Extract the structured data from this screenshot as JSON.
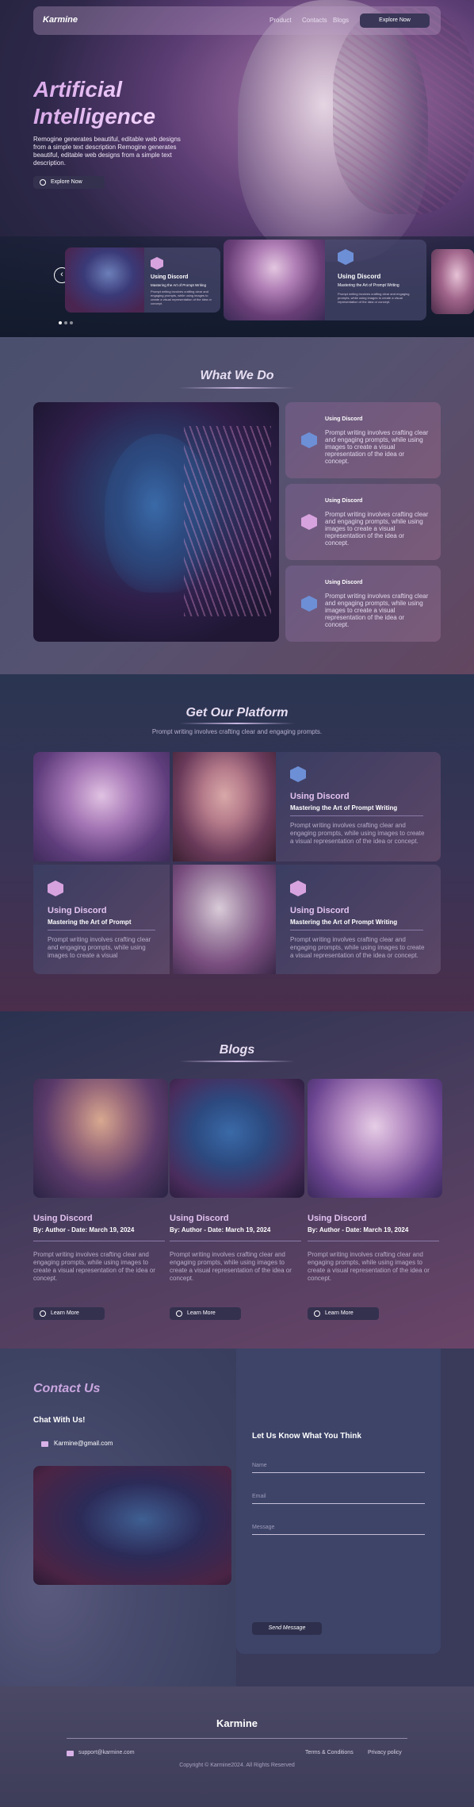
{
  "nav": {
    "logo": "Karmine",
    "links": [
      "Product",
      "Contacts",
      "Blogs"
    ],
    "cta": "Explore Now"
  },
  "hero": {
    "title_line1": "Artificial",
    "title_line2": "Intelligence",
    "description": "Remogine generates beautiful, editable web designs from a simple text description Remogine generates beautiful, editable web designs from a simple text description.",
    "cta": "Explore Now"
  },
  "carousel": {
    "cards": [
      {
        "title": "Using Discord",
        "subtitle": "Mastering the Art of Prompt Writing",
        "body": "Prompt writing involves crafting clear and engaging prompts, while using images to create a visual representation of the idea or concept."
      },
      {
        "title": "Using Discord",
        "subtitle": "Mastering the Art of Prompt Writing",
        "body": "Prompt writing involves crafting clear and engaging prompts, while using images to create a visual representation of the idea or concept."
      }
    ]
  },
  "what_we_do": {
    "title": "What We Do",
    "cards": [
      {
        "title": "Using Discord",
        "body": "Prompt writing involves crafting clear and engaging prompts, while using images to create a visual representation of the idea or concept."
      },
      {
        "title": "Using Discord",
        "body": "Prompt writing involves crafting clear and engaging prompts, while using images to create a visual representation of the idea or concept."
      },
      {
        "title": "Using Discord",
        "body": "Prompt writing involves crafting clear and engaging prompts, while using images to create a visual representation of the idea or concept."
      }
    ]
  },
  "platform": {
    "title": "Get Our Platform",
    "subtitle": "Prompt writing involves crafting clear and engaging prompts.",
    "cards": [
      {
        "title": "Using Discord",
        "subtitle": "Mastering the Art of Prompt Writing",
        "body": "Prompt writing involves crafting clear and engaging prompts, while using images to create a visual representation of the idea or concept."
      },
      {
        "title": "Using Discord",
        "subtitle": "Mastering the Art of Prompt",
        "body": "Prompt writing involves crafting clear and engaging prompts, while using images to create a visual"
      },
      {
        "title": "Using Discord",
        "subtitle": "Mastering the Art of Prompt Writing",
        "body": "Prompt writing involves crafting clear and engaging prompts, while using images to create a visual representation of the idea or concept."
      }
    ]
  },
  "blogs": {
    "title": "Blogs",
    "posts": [
      {
        "title": "Using Discord",
        "meta": "By: Author - Date: March 19, 2024",
        "body": "Prompt writing involves crafting clear and engaging prompts, while using images to create a visual representation of the idea or concept.",
        "cta": "Learn More"
      },
      {
        "title": "Using Discord",
        "meta": "By: Author - Date: March 19, 2024",
        "body": "Prompt writing involves crafting clear and engaging prompts, while using images to create a visual representation of the idea or concept.",
        "cta": "Learn More"
      },
      {
        "title": "Using Discord",
        "meta": "By: Author - Date: March 19, 2024",
        "body": "Prompt writing involves crafting clear and engaging prompts, while using images to create a visual representation of the idea or concept.",
        "cta": "Learn More"
      }
    ]
  },
  "contact": {
    "title": "Contact Us",
    "chat_title": "Chat With Us!",
    "email": "Karmine@gmail.com",
    "form_title": "Let Us Know What You Think",
    "fields": [
      "Name",
      "Email",
      "Message"
    ],
    "submit": "Send Message"
  },
  "footer": {
    "logo": "Karmine",
    "email": "support@karmine.com",
    "terms": "Terms & Conditions",
    "privacy": "Privacy policy",
    "copyright": "Copyright © Karmine2024. All Rights Reserved"
  },
  "colors": {
    "accent": "#d7a3df",
    "hex_blue": "#6d8fd6",
    "dark_button": "#34314f"
  }
}
